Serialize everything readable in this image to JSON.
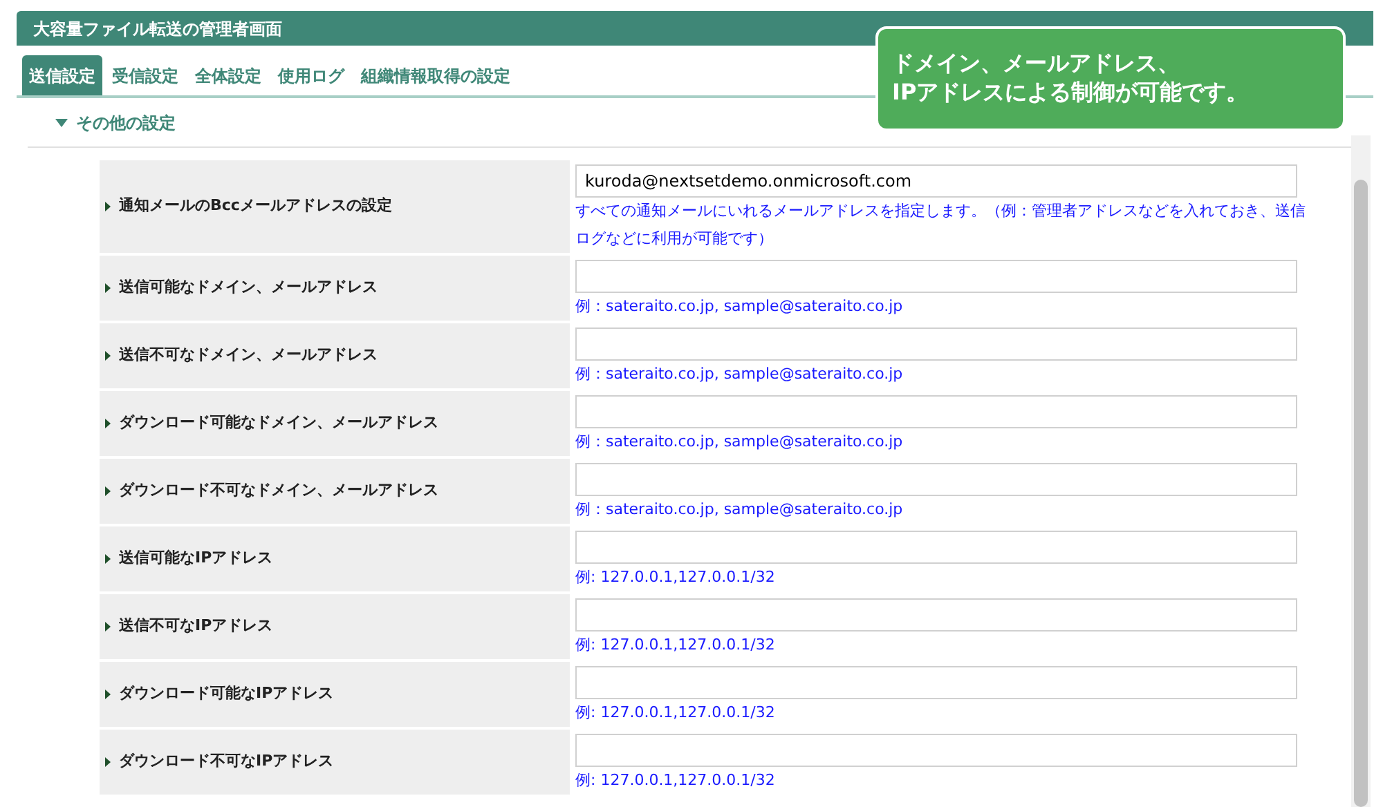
{
  "window": {
    "title": "大容量ファイル転送の管理者画面"
  },
  "tabs": [
    {
      "label": "送信設定",
      "selected": true
    },
    {
      "label": "受信設定",
      "selected": false
    },
    {
      "label": "全体設定",
      "selected": false
    },
    {
      "label": "使用ログ",
      "selected": false
    },
    {
      "label": "組織情報取得の設定",
      "selected": false
    }
  ],
  "section": {
    "title": "その他の設定",
    "expanded": true
  },
  "settings": [
    {
      "label": "通知メールのBccメールアドレスの設定",
      "value": "kuroda@nextsetdemo.onmicrosoft.com",
      "hint": "すべての通知メールにいれるメールアドレスを指定します。（例：管理者アドレスなどを入れておき、送信ログなどに利用が可能です）"
    },
    {
      "label": "送信可能なドメイン、メールアドレス",
      "hint": "例：sateraito.co.jp, sample@sateraito.co.jp"
    },
    {
      "label": "送信不可なドメイン、メールアドレス",
      "hint": "例：sateraito.co.jp, sample@sateraito.co.jp"
    },
    {
      "label": "ダウンロード可能なドメイン、メールアドレス",
      "hint": "例：sateraito.co.jp, sample@sateraito.co.jp"
    },
    {
      "label": "ダウンロード不可なドメイン、メールアドレス",
      "hint": "例：sateraito.co.jp, sample@sateraito.co.jp"
    },
    {
      "label": "送信可能なIPアドレス",
      "hint": "例: 127.0.0.1,127.0.0.1/32"
    },
    {
      "label": "送信不可なIPアドレス",
      "hint": "例: 127.0.0.1,127.0.0.1/32"
    },
    {
      "label": "ダウンロード可能なIPアドレス",
      "hint": "例: 127.0.0.1,127.0.0.1/32"
    },
    {
      "label": "ダウンロード不可なIPアドレス",
      "hint": "例: 127.0.0.1,127.0.0.1/32"
    }
  ],
  "callout": {
    "lines": [
      "ドメイン、メールアドレス、",
      "IPアドレスによる制御が可能です。"
    ]
  }
}
